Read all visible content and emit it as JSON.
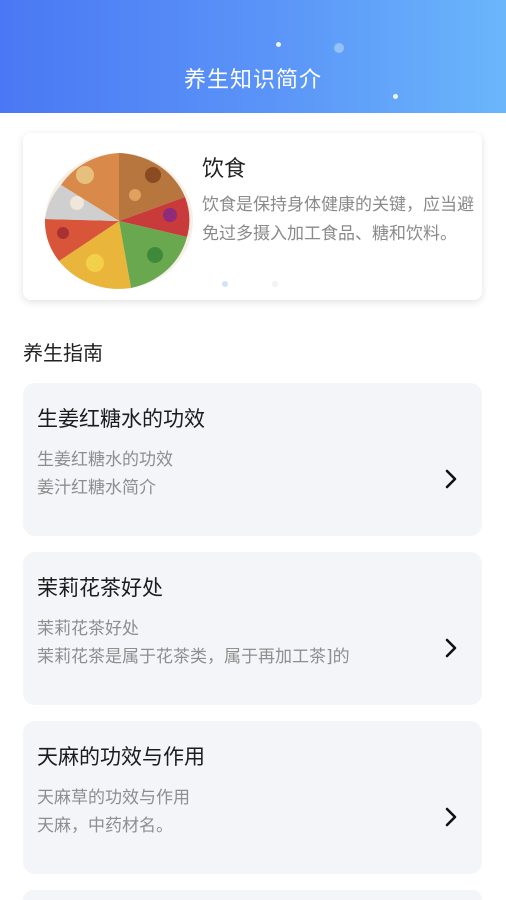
{
  "header": {
    "title": "养生知识简介"
  },
  "intro": {
    "title": "饮食",
    "description": "饮食是保持身体健康的关键，应当避免过多摄入加工食品、糖和饮料。",
    "image": "food-pyramid-image"
  },
  "guide": {
    "title": "养生指南",
    "items": [
      {
        "title": "生姜红糖水的功效",
        "line1": "生姜红糖水的功效",
        "line2": "姜汁红糖水简介"
      },
      {
        "title": "茉莉花茶好处",
        "line1": "茉莉花茶好处",
        "line2": "茉莉花茶是属于花茶类，属于再加工茶]的"
      },
      {
        "title": "天麻的功效与作用",
        "line1": "天麻草的功效与作用",
        "line2": "天麻，中药材名。"
      }
    ]
  },
  "colors": {
    "header_start": "#4a78f4",
    "header_end": "#6ab6fb",
    "card_bg": "#f4f5f9",
    "muted_text": "#8e8e8e"
  }
}
